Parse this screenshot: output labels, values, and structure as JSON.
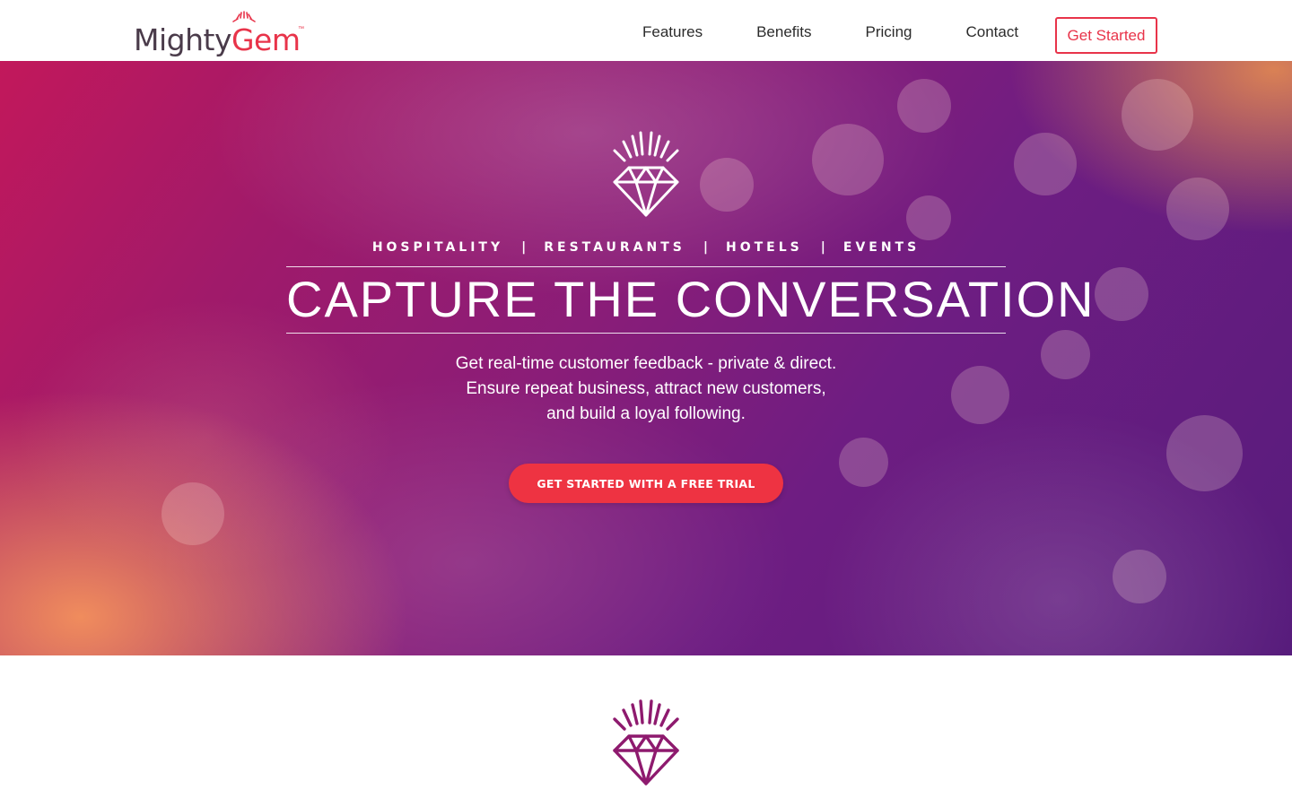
{
  "brand": {
    "name_part1": "Mighty",
    "name_part2": "Gem",
    "trademark": "™",
    "dark_color": "#4a3b4a",
    "accent_color": "#e8344a"
  },
  "nav": {
    "links": [
      {
        "label": "Features"
      },
      {
        "label": "Benefits"
      },
      {
        "label": "Pricing"
      },
      {
        "label": "Contact"
      }
    ],
    "cta_label": "Get Started"
  },
  "hero": {
    "icon": "diamond-icon",
    "categories": [
      "HOSPITALITY",
      "RESTAURANTS",
      "HOTELS",
      "EVENTS"
    ],
    "separator": "|",
    "headline": "CAPTURE THE CONVERSATION",
    "subtext_lines": [
      "Get real-time customer feedback - private & direct.",
      "Ensure repeat business, attract new customers,",
      "and build a loyal following."
    ],
    "cta_label": "GET STARTED WITH A FREE TRIAL",
    "cta_color": "#ee3342",
    "gradient_colors": [
      "#c2185b",
      "#8a1d78",
      "#571c7c"
    ]
  },
  "section": {
    "icon": "diamond-icon",
    "icon_color": "#8e1a6e"
  }
}
